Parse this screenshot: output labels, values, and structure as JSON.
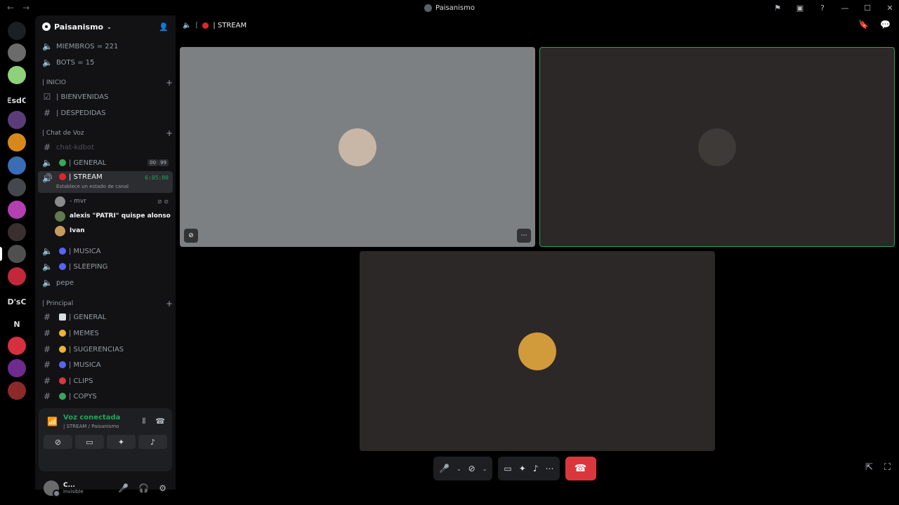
{
  "titlebar": {
    "title": "Paisanismo",
    "back": "←",
    "forward": "→"
  },
  "rail": {
    "servers": [
      {
        "name": "discord-home",
        "text": "",
        "color": "#1e1f22"
      },
      {
        "name": "server-1",
        "text": "",
        "color": "#6b6b6b"
      },
      {
        "name": "server-2",
        "text": "",
        "color": "#8fd17a"
      },
      {
        "name": "server-esdc",
        "text": "EsdC",
        "color": "transparent"
      },
      {
        "name": "server-4",
        "text": "",
        "color": "#5a3d78"
      },
      {
        "name": "server-5",
        "text": "",
        "color": "#d6891a"
      },
      {
        "name": "server-6",
        "text": "",
        "color": "#3a6db5"
      },
      {
        "name": "server-7",
        "text": "",
        "color": "#44484d"
      },
      {
        "name": "server-8",
        "text": "",
        "color": "#b33fb0"
      },
      {
        "name": "server-9",
        "text": "",
        "color": "#3b2e2e"
      },
      {
        "name": "server-paisanismo",
        "text": "",
        "color": "#4f4f4f"
      },
      {
        "name": "server-11",
        "text": "",
        "color": "#c2273a"
      },
      {
        "name": "server-dsc",
        "text": "D'sC",
        "color": "transparent"
      },
      {
        "name": "server-n",
        "text": "N",
        "color": "transparent"
      },
      {
        "name": "server-14",
        "text": "",
        "color": "#d6303f"
      },
      {
        "name": "server-15",
        "text": "",
        "color": "#6e2a8f"
      },
      {
        "name": "server-16",
        "text": "",
        "color": "#8c2a2a"
      }
    ]
  },
  "server": {
    "name": "Paisanismo"
  },
  "channels": {
    "members": "MIEMBROS = 221",
    "bots": "BOTS = 15",
    "cat_inicio": "| INICIO",
    "bienvenidas": "| BIENVENIDAS",
    "despedidas": "| DESPEDIDAS",
    "cat_voz": "| Chat de Voz",
    "chat_kdbot": "chat-kdbot",
    "general_voice": "| GENERAL",
    "general_badges": [
      "00",
      "99"
    ],
    "stream": "| STREAM",
    "stream_timer": "6:05:00",
    "stream_status": "Establece un estado de canal",
    "voice_users": [
      {
        "name": "- mvr",
        "bold": false,
        "color": "#8a8a8a"
      },
      {
        "name": "alexis \"PATRI\" quispe alonso",
        "bold": true,
        "color": "#5f7a4f"
      },
      {
        "name": "Ivan",
        "bold": true,
        "color": "#c79a5d"
      }
    ],
    "musica_voice": "| MUSICA",
    "sleeping": "| SLEEPING",
    "pepe": "pepe",
    "cat_principal": "| Principal",
    "general_text": "| GENERAL",
    "memes": "| MEMES",
    "sugerencias": "| SUGERENCIAS",
    "musica_text": "| MUSICA",
    "clips": "| CLIPS",
    "copys": "| COPYS"
  },
  "voice_panel": {
    "status": "Voz conectada",
    "sub": "| STREAM / Paisanismo"
  },
  "user": {
    "name": "C...",
    "status": "invisible"
  },
  "main": {
    "channel": "| STREAM",
    "tiles": [
      {
        "name": "tile-user-1",
        "bg": "#7c8083",
        "avatar": "#c8b7a6",
        "border": "none"
      },
      {
        "name": "tile-user-2",
        "bg": "#2b2827",
        "avatar": "#3d3a38",
        "border": "#23a55a"
      },
      {
        "name": "tile-user-3",
        "bg": "#2b2827",
        "avatar": "#d19a3b",
        "border": "none"
      }
    ]
  },
  "colors": {
    "accent_green": "#23a55a",
    "end_call": "#da373c",
    "live_red": "#e0252b"
  }
}
